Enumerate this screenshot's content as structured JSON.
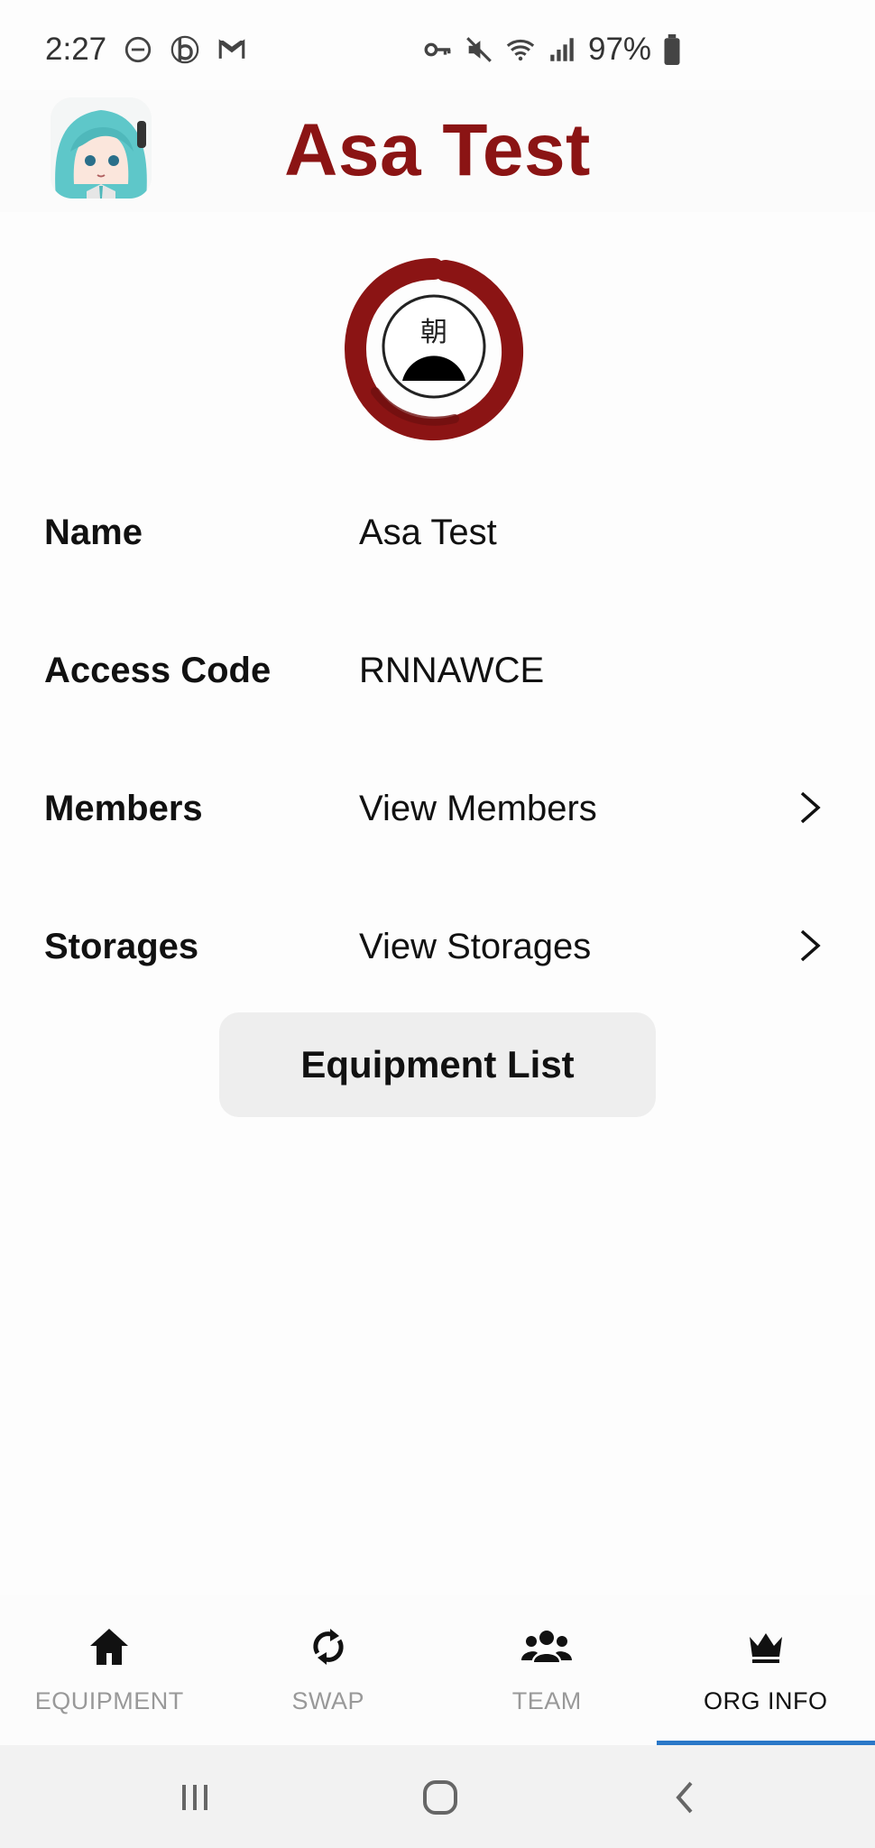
{
  "status_bar": {
    "time": "2:27",
    "left_icons": [
      "do-not-disturb-icon",
      "b-app-icon",
      "gmail-icon"
    ],
    "right_icons": [
      "vpn-key-icon",
      "mute-icon",
      "wifi-icon",
      "signal-icon"
    ],
    "battery": "97%"
  },
  "header": {
    "title": "Asa Test",
    "avatar_icon": "avatar-anime-character"
  },
  "org": {
    "logo_glyph": "朝",
    "rows": [
      {
        "label": "Name",
        "value": "Asa Test"
      },
      {
        "label": "Access Code",
        "value": "RNNAWCE"
      },
      {
        "label": "Members",
        "value": "View Members"
      },
      {
        "label": "Storages",
        "value": "View Storages"
      }
    ],
    "equipment_button": "Equipment List"
  },
  "bottom_nav": {
    "tabs": [
      {
        "label": "EQUIPMENT",
        "icon": "home-icon",
        "active": false
      },
      {
        "label": "SWAP",
        "icon": "swap-icon",
        "active": false
      },
      {
        "label": "TEAM",
        "icon": "team-icon",
        "active": false
      },
      {
        "label": "ORG INFO",
        "icon": "crown-icon",
        "active": true
      }
    ],
    "active_color": "#2a78c8"
  },
  "system_nav": [
    "recents-icon",
    "home-circle-icon",
    "back-icon"
  ],
  "colors": {
    "title": "#8b1414",
    "logo_ring": "#8b1414"
  }
}
